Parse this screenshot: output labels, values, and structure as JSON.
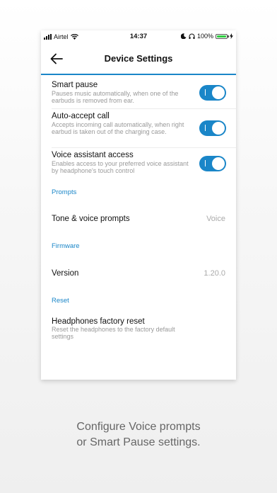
{
  "status_bar": {
    "carrier": "Airtel",
    "time": "14:37",
    "battery": "100%"
  },
  "header": {
    "title": "Device Settings"
  },
  "settings": [
    {
      "label": "Smart pause",
      "description": "Pauses music automatically, when one of the earbuds is removed from ear.",
      "enabled": true
    },
    {
      "label": "Auto-accept call",
      "description": "Accepts incoming call automatically, when right earbud is taken out of the charging case.",
      "enabled": true
    },
    {
      "label": "Voice assistant access",
      "description": "Enables access to your preferred voice assistant by headphone's touch control",
      "enabled": true
    }
  ],
  "prompts": {
    "section": "Prompts",
    "label": "Tone & voice prompts",
    "value": "Voice"
  },
  "firmware": {
    "section": "Firmware",
    "label": "Version",
    "value": "1.20.0"
  },
  "reset": {
    "section": "Reset",
    "label": "Headphones factory reset",
    "description": "Reset the headphones to the factory default settings"
  },
  "caption": {
    "line1": "Configure Voice prompts",
    "line2": "or Smart Pause settings."
  },
  "colors": {
    "accent": "#1a86c8",
    "battery": "#2ecc40"
  }
}
